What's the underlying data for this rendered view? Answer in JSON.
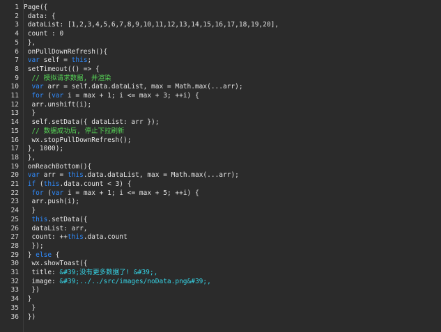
{
  "editor": {
    "colors": {
      "background": "#2b2b2b",
      "text": "#e6e6e6",
      "keyword": "#2f8cff",
      "comment": "#57d657",
      "string": "#36d4e6",
      "line_number": "#d7d7d7"
    },
    "lines": [
      {
        "n": "1",
        "tokens": [
          {
            "t": "tx",
            "v": "Page({"
          }
        ]
      },
      {
        "n": "2",
        "tokens": [
          {
            "t": "tx",
            "v": " data: {"
          }
        ]
      },
      {
        "n": "3",
        "tokens": [
          {
            "t": "tx",
            "v": " dataList: [1,2,3,4,5,6,7,8,9,10,11,12,13,14,15,16,17,18,19,20],"
          }
        ]
      },
      {
        "n": "4",
        "tokens": [
          {
            "t": "tx",
            "v": " count : 0"
          }
        ]
      },
      {
        "n": "5",
        "tokens": [
          {
            "t": "tx",
            "v": " },"
          }
        ]
      },
      {
        "n": "6",
        "tokens": [
          {
            "t": "tx",
            "v": " onPullDownRefresh(){"
          }
        ]
      },
      {
        "n": "7",
        "tokens": [
          {
            "t": "kw",
            "v": " var"
          },
          {
            "t": "tx",
            "v": " self = "
          },
          {
            "t": "kw",
            "v": "this"
          },
          {
            "t": "tx",
            "v": ";"
          }
        ]
      },
      {
        "n": "8",
        "tokens": [
          {
            "t": "tx",
            "v": " setTimeout(() => {"
          }
        ]
      },
      {
        "n": "9",
        "tokens": [
          {
            "t": "cm",
            "v": "  // 模拟请求数据, 并渲染"
          }
        ]
      },
      {
        "n": "10",
        "tokens": [
          {
            "t": "kw",
            "v": "  var"
          },
          {
            "t": "tx",
            "v": " arr = self.data.dataList, max = Math.max(...arr);"
          }
        ]
      },
      {
        "n": "11",
        "tokens": [
          {
            "t": "kw",
            "v": "  for"
          },
          {
            "t": "tx",
            "v": " ("
          },
          {
            "t": "kw",
            "v": "var"
          },
          {
            "t": "tx",
            "v": " i = max + 1; i <= max + 3; ++i) {"
          }
        ]
      },
      {
        "n": "12",
        "tokens": [
          {
            "t": "tx",
            "v": "  arr.unshift(i);"
          }
        ]
      },
      {
        "n": "13",
        "tokens": [
          {
            "t": "tx",
            "v": "  }"
          }
        ]
      },
      {
        "n": "14",
        "tokens": [
          {
            "t": "tx",
            "v": "  self.setData({ dataList: arr });"
          }
        ]
      },
      {
        "n": "15",
        "tokens": [
          {
            "t": "cm",
            "v": "  // 数据成功后, 停止下拉刷新"
          }
        ]
      },
      {
        "n": "16",
        "tokens": [
          {
            "t": "tx",
            "v": "  wx.stopPullDownRefresh();"
          }
        ]
      },
      {
        "n": "17",
        "tokens": [
          {
            "t": "tx",
            "v": " }, 1000);"
          }
        ]
      },
      {
        "n": "18",
        "tokens": [
          {
            "t": "tx",
            "v": " },"
          }
        ]
      },
      {
        "n": "19",
        "tokens": [
          {
            "t": "tx",
            "v": " onReachBottom(){"
          }
        ]
      },
      {
        "n": "20",
        "tokens": [
          {
            "t": "kw",
            "v": " var"
          },
          {
            "t": "tx",
            "v": " arr = "
          },
          {
            "t": "kw",
            "v": "this"
          },
          {
            "t": "tx",
            "v": ".data.dataList, max = Math.max(...arr);"
          }
        ]
      },
      {
        "n": "21",
        "tokens": [
          {
            "t": "kw",
            "v": " if"
          },
          {
            "t": "tx",
            "v": " ("
          },
          {
            "t": "kw",
            "v": "this"
          },
          {
            "t": "tx",
            "v": ".data.count < 3) {"
          }
        ]
      },
      {
        "n": "22",
        "tokens": [
          {
            "t": "kw",
            "v": "  for"
          },
          {
            "t": "tx",
            "v": " ("
          },
          {
            "t": "kw",
            "v": "var"
          },
          {
            "t": "tx",
            "v": " i = max + 1; i <= max + 5; ++i) {"
          }
        ]
      },
      {
        "n": "23",
        "tokens": [
          {
            "t": "tx",
            "v": "  arr.push(i);"
          }
        ]
      },
      {
        "n": "24",
        "tokens": [
          {
            "t": "tx",
            "v": "  }"
          }
        ]
      },
      {
        "n": "25",
        "tokens": [
          {
            "t": "kw",
            "v": "  this"
          },
          {
            "t": "tx",
            "v": ".setData({"
          }
        ]
      },
      {
        "n": "26",
        "tokens": [
          {
            "t": "tx",
            "v": "  dataList: arr,"
          }
        ]
      },
      {
        "n": "27",
        "tokens": [
          {
            "t": "tx",
            "v": "  count: ++"
          },
          {
            "t": "kw",
            "v": "this"
          },
          {
            "t": "tx",
            "v": ".data.count"
          }
        ]
      },
      {
        "n": "28",
        "tokens": [
          {
            "t": "tx",
            "v": "  });"
          }
        ]
      },
      {
        "n": "29",
        "tokens": [
          {
            "t": "tx",
            "v": " } "
          },
          {
            "t": "kw",
            "v": "else"
          },
          {
            "t": "tx",
            "v": " {"
          }
        ]
      },
      {
        "n": "30",
        "tokens": [
          {
            "t": "tx",
            "v": "  wx.showToast({"
          }
        ]
      },
      {
        "n": "31",
        "tokens": [
          {
            "t": "tx",
            "v": "  title: "
          },
          {
            "t": "str",
            "v": "&#39;没有更多数据了! &#39;,"
          }
        ]
      },
      {
        "n": "32",
        "tokens": [
          {
            "t": "tx",
            "v": "  image: "
          },
          {
            "t": "str",
            "v": "&#39;../../src/images/noData.png&#39;,"
          }
        ]
      },
      {
        "n": "33",
        "tokens": [
          {
            "t": "tx",
            "v": "  })"
          }
        ]
      },
      {
        "n": "34",
        "tokens": [
          {
            "t": "tx",
            "v": " }"
          }
        ]
      },
      {
        "n": "35",
        "tokens": [
          {
            "t": "tx",
            "v": "  }"
          }
        ]
      },
      {
        "n": "36",
        "tokens": [
          {
            "t": "tx",
            "v": " })"
          }
        ]
      }
    ]
  }
}
